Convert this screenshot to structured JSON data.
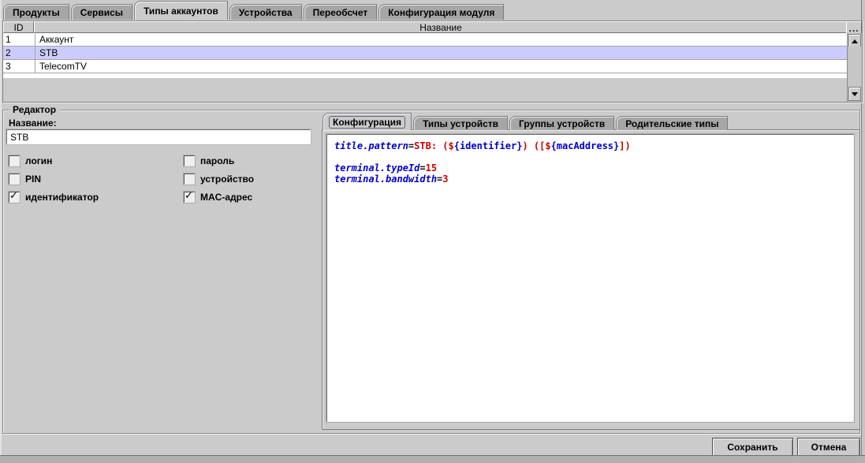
{
  "window": {
    "tabs": [
      "Продукты",
      "Сервисы",
      "Типы аккаунтов",
      "Устройства",
      "Переобсчет",
      "Конфигурация модуля"
    ],
    "active_tab": "Типы аккаунтов"
  },
  "table": {
    "columns": [
      "ID",
      "Название"
    ],
    "corner_button_label": "...",
    "rows": [
      {
        "id": "1",
        "name": "Аккаунт",
        "selected": false
      },
      {
        "id": "2",
        "name": "STB",
        "selected": true
      },
      {
        "id": "3",
        "name": "TelecomTV",
        "selected": false
      }
    ]
  },
  "editor": {
    "group_title": "Редактор",
    "name_label": "Название:",
    "name_value": "STB",
    "checkboxes": [
      {
        "label": "логин",
        "checked": false
      },
      {
        "label": "пароль",
        "checked": false
      },
      {
        "label": "PIN",
        "checked": false
      },
      {
        "label": "устройство",
        "checked": false
      },
      {
        "label": "идентификатор",
        "checked": true
      },
      {
        "label": "MAC-адрес",
        "checked": true
      }
    ],
    "tabs": [
      "Конфигурация",
      "Типы устройств",
      "Группы устройств",
      "Родительские типы"
    ],
    "active_tab": "Конфигурация",
    "config_lines": [
      {
        "segments": [
          {
            "text": "title.pattern",
            "style": "key"
          },
          {
            "text": "=",
            "style": "op"
          },
          {
            "text": "STB: ($",
            "style": "val"
          },
          {
            "text": "{identifier}",
            "style": "var"
          },
          {
            "text": ") ([$",
            "style": "val"
          },
          {
            "text": "{macAddress}",
            "style": "var"
          },
          {
            "text": "])",
            "style": "val"
          }
        ]
      },
      {
        "segments": []
      },
      {
        "segments": [
          {
            "text": "terminal.typeId",
            "style": "key"
          },
          {
            "text": "=",
            "style": "op"
          },
          {
            "text": "15",
            "style": "val"
          }
        ]
      },
      {
        "segments": [
          {
            "text": "terminal.bandwidth",
            "style": "key"
          },
          {
            "text": "=",
            "style": "op"
          },
          {
            "text": "3",
            "style": "val"
          }
        ]
      }
    ]
  },
  "buttons": {
    "save": "Сохранить",
    "cancel": "Отмена"
  },
  "colors": {
    "background": "#cbcbcb",
    "inactive_tab": "#a6a6a6",
    "selected_row": "#ccccfc",
    "syntax_key_blue": "#0000cd",
    "syntax_value_red": "#cd0000"
  }
}
